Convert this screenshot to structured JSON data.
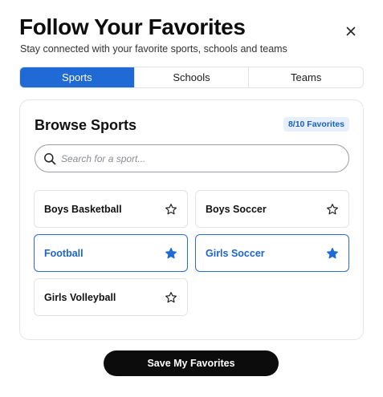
{
  "header": {
    "title": "Follow Your Favorites",
    "subtitle": "Stay connected with your favorite sports, schools and teams"
  },
  "tabs": [
    {
      "label": "Sports",
      "active": true
    },
    {
      "label": "Schools",
      "active": false
    },
    {
      "label": "Teams",
      "active": false
    }
  ],
  "panel": {
    "title": "Browse Sports",
    "badge": "8/10 Favorites",
    "search_placeholder": "Search for a sport..."
  },
  "sports": [
    {
      "label": "Boys Basketball",
      "favorited": false
    },
    {
      "label": "Boys Soccer",
      "favorited": false
    },
    {
      "label": "Football",
      "favorited": true
    },
    {
      "label": "Girls Soccer",
      "favorited": true
    },
    {
      "label": "Girls Volleyball",
      "favorited": false
    }
  ],
  "footer": {
    "save_label": "Save My Favorites"
  },
  "colors": {
    "accent": "#1f6ad4",
    "badge_bg": "#e6f0fc",
    "badge_text": "#1c5fb8",
    "save_button": "#0c0c0c"
  }
}
